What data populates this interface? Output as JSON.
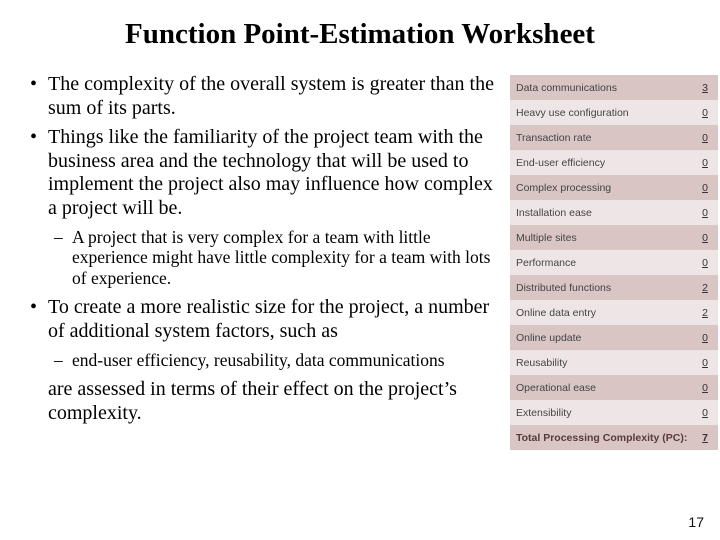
{
  "title": "Function Point-Estimation Worksheet",
  "bullets": {
    "b1": "The complexity of the overall system is greater than the sum of its parts.",
    "b2": "Things like the familiarity of the project team with the business area and the technology that will be used to implement the project also may influence how complex a project will be.",
    "b2a": "A project that is very complex for a team with little experience might have little complexity for a team with lots of experience.",
    "b3": "To create a more realistic size for the project, a number of additional system factors, such as",
    "b3a": "end-user efficiency, reusability, data communications",
    "b3cont": "are assessed in terms of their effect on the project’s complexity."
  },
  "table": {
    "rows": [
      {
        "label": "Data communications",
        "value": "3"
      },
      {
        "label": "Heavy use configuration",
        "value": "0"
      },
      {
        "label": "Transaction rate",
        "value": "0"
      },
      {
        "label": "End-user efficiency",
        "value": "0"
      },
      {
        "label": "Complex processing",
        "value": "0"
      },
      {
        "label": "Installation ease",
        "value": "0"
      },
      {
        "label": "Multiple sites",
        "value": "0"
      },
      {
        "label": "Performance",
        "value": "0"
      },
      {
        "label": "Distributed functions",
        "value": "2"
      },
      {
        "label": "Online data entry",
        "value": "2"
      },
      {
        "label": "Online update",
        "value": "0"
      },
      {
        "label": "Reusability",
        "value": "0"
      },
      {
        "label": "Operational ease",
        "value": "0"
      },
      {
        "label": "Extensibility",
        "value": "0"
      }
    ],
    "total": {
      "label": "Total Processing Complexity (PC):",
      "value": "7"
    }
  },
  "pagenum": "17"
}
